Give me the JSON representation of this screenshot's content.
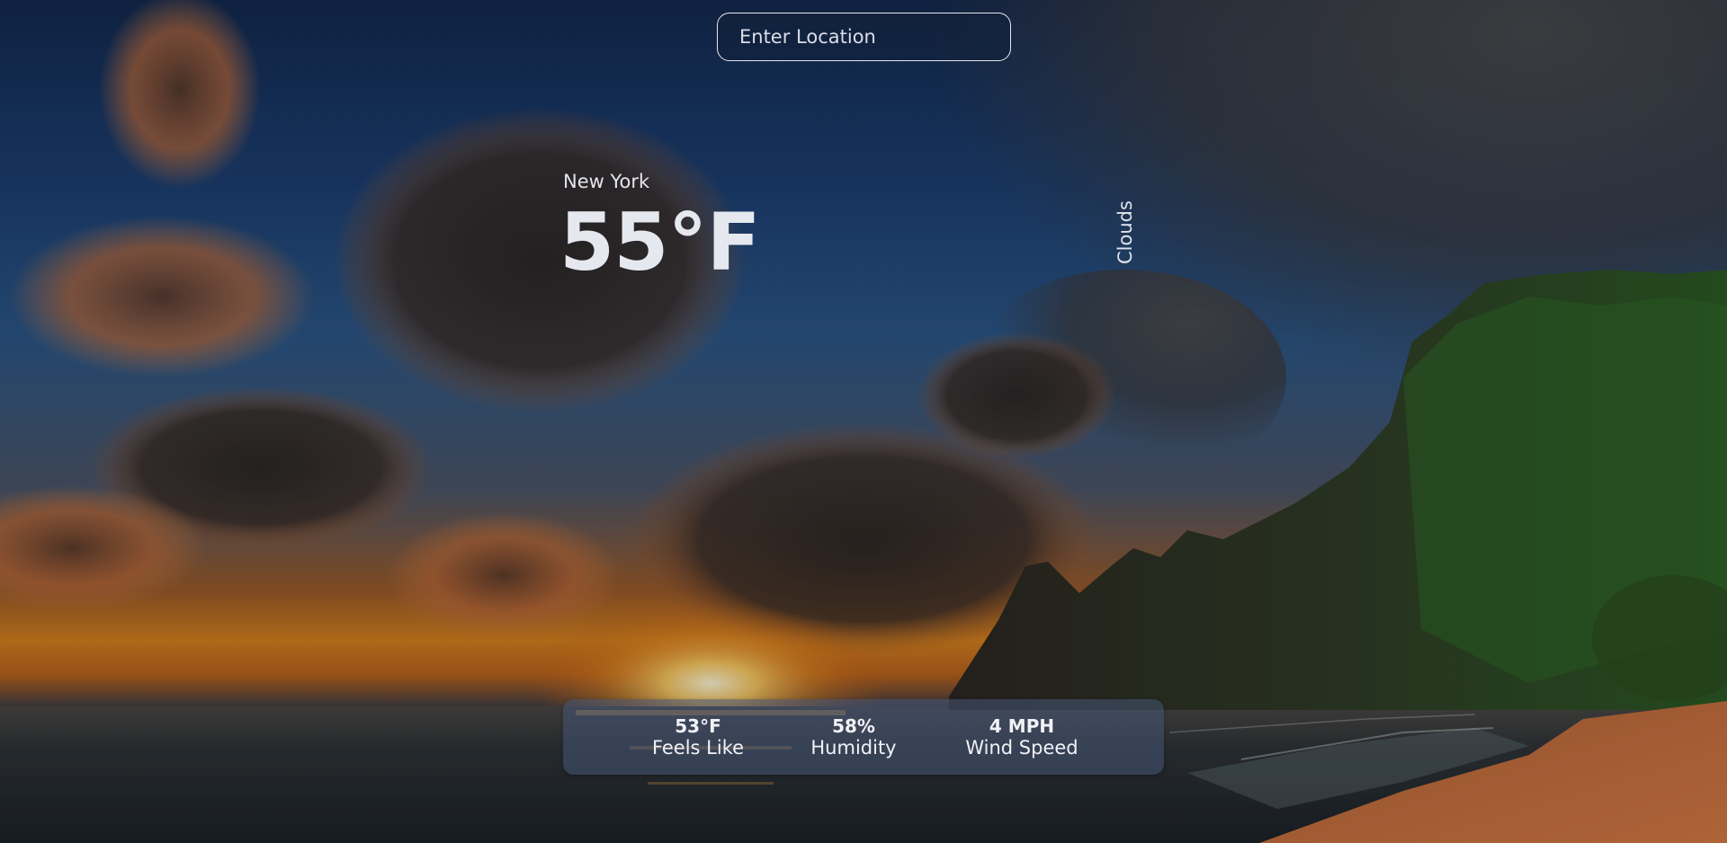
{
  "search": {
    "placeholder": "Enter Location",
    "value": ""
  },
  "weather": {
    "location": "New York",
    "temperature": "55°F",
    "description": "Clouds"
  },
  "stats": {
    "feels_like": {
      "value": "53°F",
      "label": "Feels Like"
    },
    "humidity": {
      "value": "58%",
      "label": "Humidity"
    },
    "wind_speed": {
      "value": "4 MPH",
      "label": "Wind Speed"
    }
  }
}
